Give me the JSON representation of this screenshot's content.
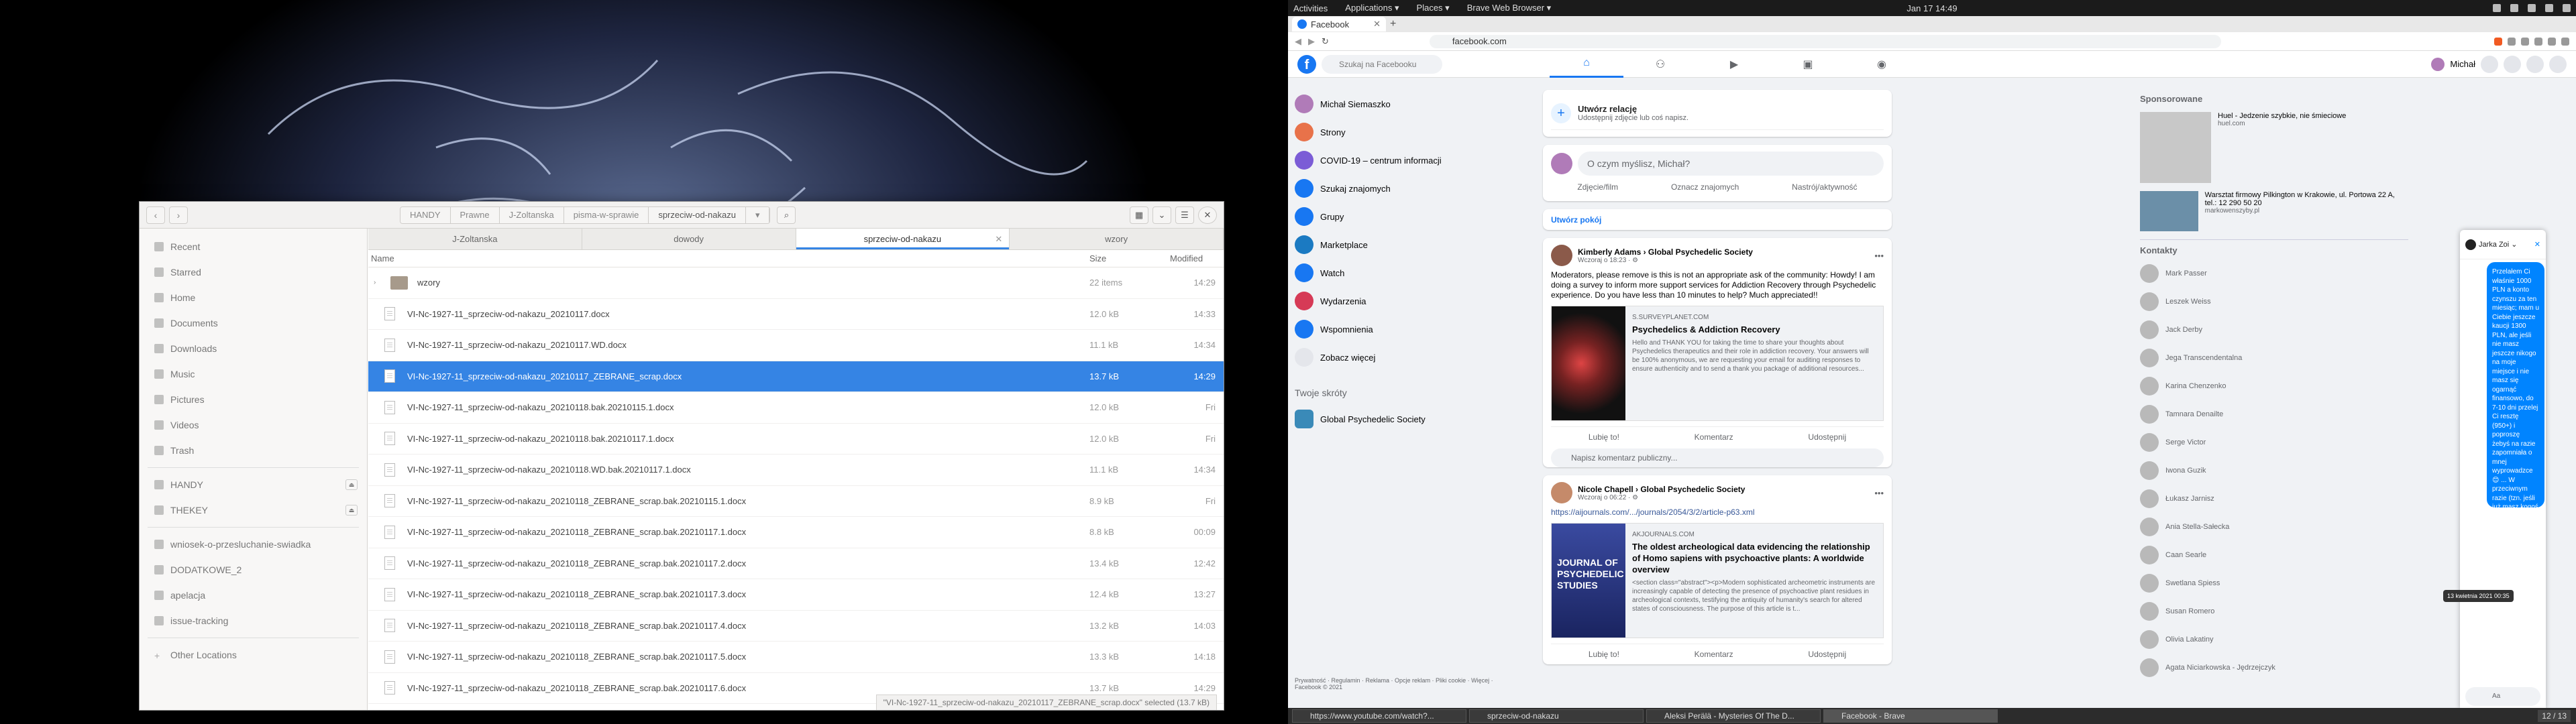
{
  "topbar": {
    "activities": "Activities",
    "applications": "Applications ▾",
    "places": "Places ▾",
    "active_app": "Brave Web Browser ▾",
    "clock": "Jan 17  14:49"
  },
  "files": {
    "breadcrumbs": [
      "HANDY",
      "Prawne",
      "J-Zoltanska",
      "pisma-w-sprawie",
      "sprzeciw-od-nakazu"
    ],
    "sidebar": [
      {
        "label": "Recent"
      },
      {
        "label": "Starred"
      },
      {
        "label": "Home"
      },
      {
        "label": "Documents"
      },
      {
        "label": "Downloads"
      },
      {
        "label": "Music"
      },
      {
        "label": "Pictures"
      },
      {
        "label": "Videos"
      },
      {
        "label": "Trash"
      }
    ],
    "devices": [
      {
        "label": "HANDY"
      },
      {
        "label": "THEKEY"
      }
    ],
    "bookmarks": [
      {
        "label": "wniosek-o-przesluchanie-swiadka"
      },
      {
        "label": "DODATKOWE_2"
      },
      {
        "label": "apelacja"
      },
      {
        "label": "issue-tracking"
      }
    ],
    "other_locations": "Other Locations",
    "tabs": [
      "J-Zoltanska",
      "dowody",
      "sprzeciw-od-nakazu",
      "wzory"
    ],
    "columns": {
      "name": "Name",
      "size": "Size",
      "modified": "Modified"
    },
    "rows": [
      {
        "name": "wzory",
        "size": "22 items",
        "modified": "14:29",
        "folder": true
      },
      {
        "name": "VI-Nc-1927-11_sprzeciw-od-nakazu_20210117.docx",
        "size": "12.0 kB",
        "modified": "14:33"
      },
      {
        "name": "VI-Nc-1927-11_sprzeciw-od-nakazu_20210117.WD.docx",
        "size": "11.1 kB",
        "modified": "14:34"
      },
      {
        "name": "VI-Nc-1927-11_sprzeciw-od-nakazu_20210117_ZEBRANE_scrap.docx",
        "size": "13.7 kB",
        "modified": "14:29",
        "selected": true
      },
      {
        "name": "VI-Nc-1927-11_sprzeciw-od-nakazu_20210118.bak.20210115.1.docx",
        "size": "12.0 kB",
        "modified": "Fri"
      },
      {
        "name": "VI-Nc-1927-11_sprzeciw-od-nakazu_20210118.bak.20210117.1.docx",
        "size": "12.0 kB",
        "modified": "Fri"
      },
      {
        "name": "VI-Nc-1927-11_sprzeciw-od-nakazu_20210118.WD.bak.20210117.1.docx",
        "size": "11.1 kB",
        "modified": "14:34"
      },
      {
        "name": "VI-Nc-1927-11_sprzeciw-od-nakazu_20210118_ZEBRANE_scrap.bak.20210115.1.docx",
        "size": "8.9 kB",
        "modified": "Fri"
      },
      {
        "name": "VI-Nc-1927-11_sprzeciw-od-nakazu_20210118_ZEBRANE_scrap.bak.20210117.1.docx",
        "size": "8.8 kB",
        "modified": "00:09"
      },
      {
        "name": "VI-Nc-1927-11_sprzeciw-od-nakazu_20210118_ZEBRANE_scrap.bak.20210117.2.docx",
        "size": "13.4 kB",
        "modified": "12:42"
      },
      {
        "name": "VI-Nc-1927-11_sprzeciw-od-nakazu_20210118_ZEBRANE_scrap.bak.20210117.3.docx",
        "size": "12.4 kB",
        "modified": "13:27"
      },
      {
        "name": "VI-Nc-1927-11_sprzeciw-od-nakazu_20210118_ZEBRANE_scrap.bak.20210117.4.docx",
        "size": "13.2 kB",
        "modified": "14:03"
      },
      {
        "name": "VI-Nc-1927-11_sprzeciw-od-nakazu_20210118_ZEBRANE_scrap.bak.20210117.5.docx",
        "size": "13.3 kB",
        "modified": "14:18"
      },
      {
        "name": "VI-Nc-1927-11_sprzeciw-od-nakazu_20210118_ZEBRANE_scrap.bak.20210117.6.docx",
        "size": "13.7 kB",
        "modified": "14:29"
      }
    ],
    "status": "\"VI-Nc-1927-11_sprzeciw-od-nakazu_20210117_ZEBRANE_scrap.docx\" selected (13.7 kB)"
  },
  "browser": {
    "tab_title": "Facebook",
    "url": "facebook.com",
    "search_placeholder": "Szukaj na Facebooku",
    "user_name": "Michał",
    "left_nav": [
      "Michał Siemaszko",
      "Strony",
      "COVID-19 – centrum informacji",
      "Szukaj znajomych",
      "Grupy",
      "Marketplace",
      "Watch",
      "Wydarzenia",
      "Wspomnienia",
      "Zobacz więcej"
    ],
    "shortcuts_heading": "Twoje skróty",
    "shortcuts": [
      "Global Psychedelic Society"
    ],
    "footer": "Prywatność · Regulamin · Reklama · Opcje reklam · Pliki cookie · Więcej · Facebook © 2021",
    "create_story": "Utwórz relację",
    "create_story_sub": "Udostępnij zdjęcie lub coś napisz.",
    "whats_on_mind": "O czym myślisz, Michał?",
    "post_actions": [
      "Zdjęcie/film",
      "Oznacz znajomych",
      "Nastrój/aktywność"
    ],
    "create_room": "Utwórz pokój",
    "posts": [
      {
        "author": "Kimberly Adams › Global Psychedelic Society",
        "time": "Wczoraj o 18:23 · ⚙",
        "text": "Moderators, please remove is this is not an appropriate ask of the community: Howdy! I am doing a survey to inform more support services for Addiction Recovery through Psychedelic experience. Do you have less than 10 minutes to help? Much appreciated!!",
        "link_domain": "S.SURVEYPLANET.COM",
        "link_title": "Psychedelics & Addiction Recovery",
        "link_desc": "Hello and THANK YOU for taking the time to share your thoughts about Psychedelics therapeutics and their role in addiction recovery. Your answers will be 100% anonymous, we are requesting your email for auditing responses to ensure authenticity and to send a thank you package of additional resources...",
        "actions": [
          "Lubię to!",
          "Komentarz",
          "Udostępnij"
        ],
        "comment_placeholder": "Napisz komentarz publiczny..."
      },
      {
        "author": "Nicole Chapell › Global Psychedelic Society",
        "time": "Wczoraj o 06:22 · ⚙",
        "text": "https://aijournals.com/.../journals/2054/3/2/article-p63.xml",
        "link_image_text": "JOURNAL OF PSYCHEDELIC STUDIES",
        "link_domain": "AKJOURNALS.COM",
        "link_title": "The oldest archeological data evidencing the relationship of Homo sapiens with psychoactive plants: A worldwide overview",
        "link_desc": "<section class=\"abstract\"><p>Modern sophisticated archeometric instruments are increasingly capable of detecting the presence of psychoactive plant residues in archeological contexts, testifying the antiquity of humanity's search for altered states of consciousness. The purpose of this article is t...",
        "actions": [
          "Lubię to!",
          "Komentarz",
          "Udostępnij"
        ]
      }
    ],
    "sponsored_heading": "Sponsorowane",
    "sponsored": [
      {
        "title": "Huel - Jedzenie szybkie, nie śmieciowe",
        "domain": "huel.com"
      },
      {
        "title": "Warsztat firmowy Pilkington w Krakowie, ul. Portowa 22 A, tel.: 12 290 50 20",
        "domain": "markowenszyby.pl"
      }
    ],
    "contacts_heading": "Kontakty",
    "contacts": [
      "Mark Passer",
      "Leszek Weiss",
      "Jack Derby",
      "Jega Transcendentalna",
      "Karina Chenzenko",
      "Tamnara Denailte",
      "Serge Victor",
      "Iwona Guzik",
      "Łukasz Jarnisz",
      "Ania Stella-Sałecka",
      "Caan Searle",
      "Swetlana Spiess",
      "Susan Romero",
      "Olivia Lakatiny",
      "Agata Niciarkowska - Jędrzejczyk"
    ],
    "chat": {
      "name": "Jarka Zoi ⌄",
      "message": "Przelałem Ci właśnie 1000 PLN a konto czynszu za ten miesiąc; mam u Ciebie jeszcze kaucji 1300 PLN, ale jeśli nie masz jeszcze nikogo na moje miejsce i nie masz się ogarnąć finansowo, do 7-10 dni przelej Ci resztę (950+) i poproszę żebyś na razie zapomniała o mnej wyprowadzce 😊 ... W przeciwnym razie (tzn. jeśli już masz kogoś lub po prostu potrzebujesz pieniądzy lepiej, że go nie pisz) przelej te pozostałe kwoty kaucji.",
      "tooltip": "13 kwietnia 2021 00:35",
      "input_placeholder": "Aa"
    }
  },
  "taskbar": {
    "tasks": [
      "https://www.youtube.com/watch?...",
      "sprzeciw-od-nakazu",
      "Aleksi Perälä - Mysteries Of The D...",
      "Facebook - Brave"
    ],
    "workspace": "12 / 13"
  }
}
